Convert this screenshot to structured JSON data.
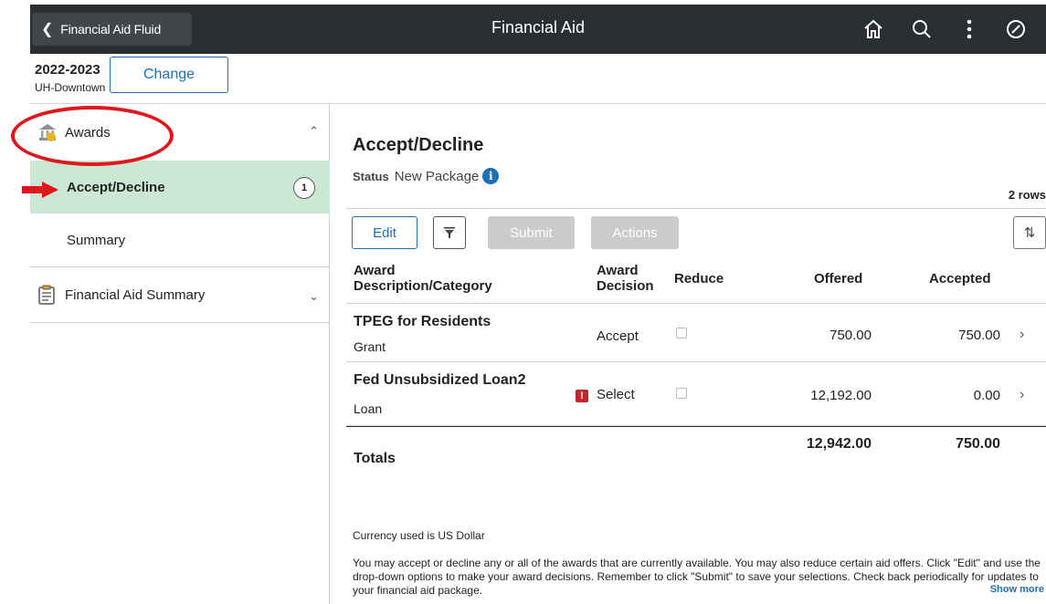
{
  "header": {
    "back_label": "Financial Aid Fluid",
    "title": "Financial Aid",
    "icons": [
      "home-icon",
      "search-icon",
      "more-vertical-icon",
      "navbar-icon"
    ]
  },
  "term": {
    "year": "2022-2023",
    "campus": "UH-Downtown",
    "change_label": "Change"
  },
  "sidebar": {
    "awards": {
      "label": "Awards",
      "items": [
        {
          "label": "Accept/Decline",
          "badge": "1",
          "active": true
        },
        {
          "label": "Summary"
        }
      ]
    },
    "fa_summary": {
      "label": "Financial Aid Summary"
    }
  },
  "main": {
    "title": "Accept/Decline",
    "status_label": "Status",
    "status_value": "New Package",
    "rows_count": "2 rows",
    "toolbar": {
      "edit": "Edit",
      "submit": "Submit",
      "actions": "Actions"
    },
    "columns": {
      "description_line1": "Award",
      "description_line2": "Description/Category",
      "decision_line1": "Award",
      "decision_line2": "Decision",
      "reduce": "Reduce",
      "offered": "Offered",
      "accepted": "Accepted"
    },
    "rows": [
      {
        "name": "TPEG for Residents",
        "category": "Grant",
        "decision": "Accept",
        "offered": "750.00",
        "accepted": "750.00"
      },
      {
        "name": "Fed Unsubsidized Loan2",
        "category": "Loan",
        "decision": "Select",
        "offered": "12,192.00",
        "accepted": "0.00"
      }
    ],
    "totals": {
      "label": "Totals",
      "offered": "12,942.00",
      "accepted": "750.00"
    },
    "currency_note": "Currency used is US Dollar",
    "info_text": "You may accept or decline any or all of the awards that are currently available. You may also reduce certain aid offers. Click \"Edit\" and use the drop-down options to make your award decisions. Remember to click \"Submit\" to save your selections. Check back periodically for updates to your financial aid package.",
    "show_more": "Show more"
  },
  "colors": {
    "header_bg": "#2b2f33",
    "accent": "#1d6fb8",
    "active_item_bg": "#cbe8d4",
    "annotation_red": "#e0161c"
  }
}
